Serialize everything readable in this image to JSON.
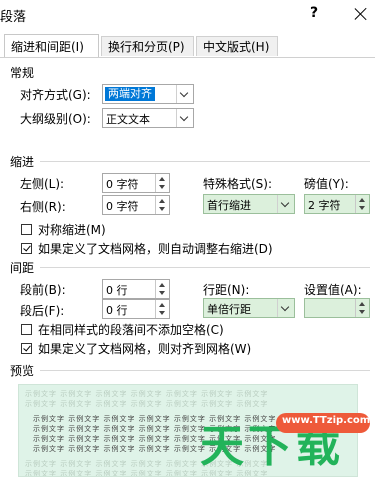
{
  "dialog": {
    "title": "段落",
    "help": "?"
  },
  "tabs": [
    {
      "label": "缩进和间距(I)"
    },
    {
      "label": "换行和分页(P)"
    },
    {
      "label": "中文版式(H)"
    }
  ],
  "general": {
    "heading": "常规",
    "alignment_label": "对齐方式(G):",
    "alignment_value": "两端对齐",
    "outline_label": "大纲级别(O):",
    "outline_value": "正文文本"
  },
  "indent": {
    "heading": "缩进",
    "left_label": "左侧(L):",
    "left_value": "0 字符",
    "right_label": "右侧(R):",
    "right_value": "0 字符",
    "special_label": "特殊格式(S):",
    "special_value": "首行缩进",
    "by_label": "磅值(Y):",
    "by_value": "2 字符",
    "mirror_label": "对称缩进(M)",
    "mirror_checked": false,
    "auto_adjust_label": "如果定义了文档网格，则自动调整右缩进(D)",
    "auto_adjust_checked": true
  },
  "spacing": {
    "heading": "间距",
    "before_label": "段前(B):",
    "before_value": "0 行",
    "after_label": "段后(F):",
    "after_value": "0 行",
    "line_label": "行距(N):",
    "line_value": "单倍行距",
    "at_label": "设置值(A):",
    "at_value": "",
    "no_space_label": "在相同样式的段落间不添加空格(C)",
    "no_space_checked": false,
    "snap_grid_label": "如果定义了文档网格，则对齐到网格(W)",
    "snap_grid_checked": true
  },
  "preview": {
    "heading": "预览",
    "sample_line": "示例文字 示例文字 示例文字 示例文字 示例文字 示例文字 示例文字"
  },
  "watermark": {
    "url": "www.TTzip.com",
    "text": "天下载"
  },
  "colors": {
    "accent": "#0078d7",
    "field_green": "#dcf0dc",
    "preview_bg": "#dff3e8",
    "watermark_green": "#22b35a",
    "watermark_pill": "#ee5a3a"
  }
}
